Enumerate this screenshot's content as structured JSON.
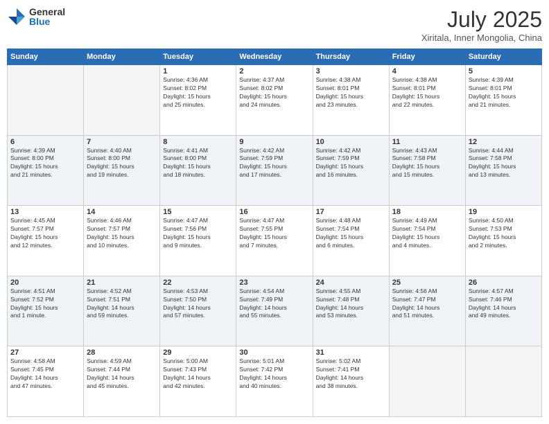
{
  "logo": {
    "general": "General",
    "blue": "Blue"
  },
  "title": "July 2025",
  "location": "Xiritala, Inner Mongolia, China",
  "days_of_week": [
    "Sunday",
    "Monday",
    "Tuesday",
    "Wednesday",
    "Thursday",
    "Friday",
    "Saturday"
  ],
  "weeks": [
    [
      {
        "day": "",
        "info": ""
      },
      {
        "day": "",
        "info": ""
      },
      {
        "day": "1",
        "info": "Sunrise: 4:36 AM\nSunset: 8:02 PM\nDaylight: 15 hours\nand 25 minutes."
      },
      {
        "day": "2",
        "info": "Sunrise: 4:37 AM\nSunset: 8:02 PM\nDaylight: 15 hours\nand 24 minutes."
      },
      {
        "day": "3",
        "info": "Sunrise: 4:38 AM\nSunset: 8:01 PM\nDaylight: 15 hours\nand 23 minutes."
      },
      {
        "day": "4",
        "info": "Sunrise: 4:38 AM\nSunset: 8:01 PM\nDaylight: 15 hours\nand 22 minutes."
      },
      {
        "day": "5",
        "info": "Sunrise: 4:39 AM\nSunset: 8:01 PM\nDaylight: 15 hours\nand 21 minutes."
      }
    ],
    [
      {
        "day": "6",
        "info": "Sunrise: 4:39 AM\nSunset: 8:00 PM\nDaylight: 15 hours\nand 21 minutes."
      },
      {
        "day": "7",
        "info": "Sunrise: 4:40 AM\nSunset: 8:00 PM\nDaylight: 15 hours\nand 19 minutes."
      },
      {
        "day": "8",
        "info": "Sunrise: 4:41 AM\nSunset: 8:00 PM\nDaylight: 15 hours\nand 18 minutes."
      },
      {
        "day": "9",
        "info": "Sunrise: 4:42 AM\nSunset: 7:59 PM\nDaylight: 15 hours\nand 17 minutes."
      },
      {
        "day": "10",
        "info": "Sunrise: 4:42 AM\nSunset: 7:59 PM\nDaylight: 15 hours\nand 16 minutes."
      },
      {
        "day": "11",
        "info": "Sunrise: 4:43 AM\nSunset: 7:58 PM\nDaylight: 15 hours\nand 15 minutes."
      },
      {
        "day": "12",
        "info": "Sunrise: 4:44 AM\nSunset: 7:58 PM\nDaylight: 15 hours\nand 13 minutes."
      }
    ],
    [
      {
        "day": "13",
        "info": "Sunrise: 4:45 AM\nSunset: 7:57 PM\nDaylight: 15 hours\nand 12 minutes."
      },
      {
        "day": "14",
        "info": "Sunrise: 4:46 AM\nSunset: 7:57 PM\nDaylight: 15 hours\nand 10 minutes."
      },
      {
        "day": "15",
        "info": "Sunrise: 4:47 AM\nSunset: 7:56 PM\nDaylight: 15 hours\nand 9 minutes."
      },
      {
        "day": "16",
        "info": "Sunrise: 4:47 AM\nSunset: 7:55 PM\nDaylight: 15 hours\nand 7 minutes."
      },
      {
        "day": "17",
        "info": "Sunrise: 4:48 AM\nSunset: 7:54 PM\nDaylight: 15 hours\nand 6 minutes."
      },
      {
        "day": "18",
        "info": "Sunrise: 4:49 AM\nSunset: 7:54 PM\nDaylight: 15 hours\nand 4 minutes."
      },
      {
        "day": "19",
        "info": "Sunrise: 4:50 AM\nSunset: 7:53 PM\nDaylight: 15 hours\nand 2 minutes."
      }
    ],
    [
      {
        "day": "20",
        "info": "Sunrise: 4:51 AM\nSunset: 7:52 PM\nDaylight: 15 hours\nand 1 minute."
      },
      {
        "day": "21",
        "info": "Sunrise: 4:52 AM\nSunset: 7:51 PM\nDaylight: 14 hours\nand 59 minutes."
      },
      {
        "day": "22",
        "info": "Sunrise: 4:53 AM\nSunset: 7:50 PM\nDaylight: 14 hours\nand 57 minutes."
      },
      {
        "day": "23",
        "info": "Sunrise: 4:54 AM\nSunset: 7:49 PM\nDaylight: 14 hours\nand 55 minutes."
      },
      {
        "day": "24",
        "info": "Sunrise: 4:55 AM\nSunset: 7:48 PM\nDaylight: 14 hours\nand 53 minutes."
      },
      {
        "day": "25",
        "info": "Sunrise: 4:56 AM\nSunset: 7:47 PM\nDaylight: 14 hours\nand 51 minutes."
      },
      {
        "day": "26",
        "info": "Sunrise: 4:57 AM\nSunset: 7:46 PM\nDaylight: 14 hours\nand 49 minutes."
      }
    ],
    [
      {
        "day": "27",
        "info": "Sunrise: 4:58 AM\nSunset: 7:45 PM\nDaylight: 14 hours\nand 47 minutes."
      },
      {
        "day": "28",
        "info": "Sunrise: 4:59 AM\nSunset: 7:44 PM\nDaylight: 14 hours\nand 45 minutes."
      },
      {
        "day": "29",
        "info": "Sunrise: 5:00 AM\nSunset: 7:43 PM\nDaylight: 14 hours\nand 42 minutes."
      },
      {
        "day": "30",
        "info": "Sunrise: 5:01 AM\nSunset: 7:42 PM\nDaylight: 14 hours\nand 40 minutes."
      },
      {
        "day": "31",
        "info": "Sunrise: 5:02 AM\nSunset: 7:41 PM\nDaylight: 14 hours\nand 38 minutes."
      },
      {
        "day": "",
        "info": ""
      },
      {
        "day": "",
        "info": ""
      }
    ]
  ]
}
